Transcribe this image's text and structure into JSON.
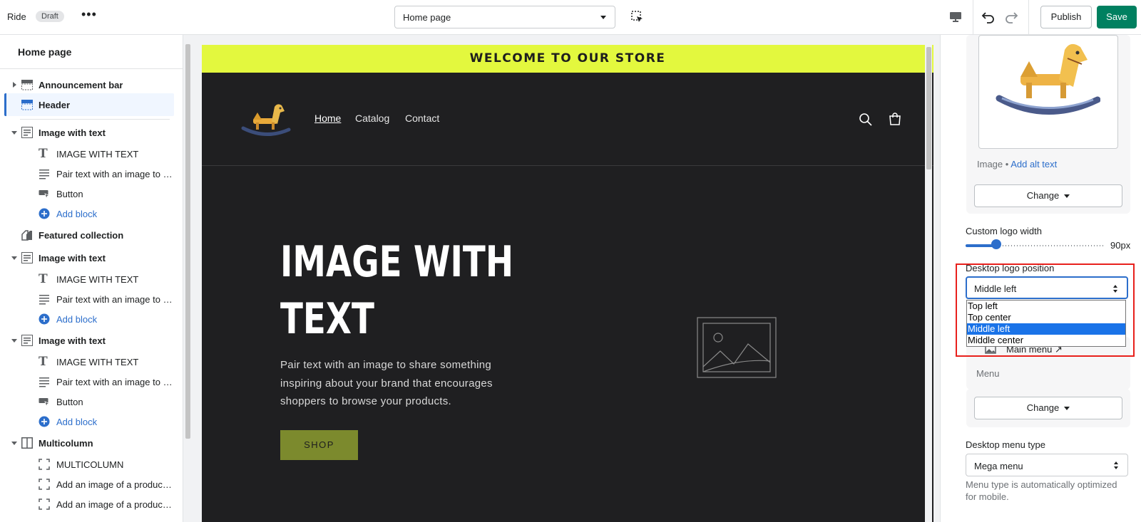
{
  "topbar": {
    "app_name": "Ride",
    "status_badge": "Draft",
    "more_label": "•••",
    "page_select_value": "Home page",
    "publish_label": "Publish",
    "save_label": "Save"
  },
  "sidebar": {
    "title": "Home page",
    "rows": {
      "announcement_bar": "Announcement bar",
      "header": "Header",
      "iwt1": "Image with text",
      "iwt1_heading": "IMAGE WITH TEXT",
      "iwt1_text": "Pair text with an image to s...",
      "iwt1_button": "Button",
      "iwt1_add": "Add block",
      "featured_collection": "Featured collection",
      "iwt2": "Image with text",
      "iwt2_heading": "IMAGE WITH TEXT",
      "iwt2_text": "Pair text with an image to s...",
      "iwt2_add": "Add block",
      "iwt3": "Image with text",
      "iwt3_heading": "IMAGE WITH TEXT",
      "iwt3_text": "Pair text with an image to f...",
      "iwt3_button": "Button",
      "iwt3_add": "Add block",
      "multicolumn": "Multicolumn",
      "mc_heading": "MULTICOLUMN",
      "mc_col1": "Add an image of a product ...",
      "mc_col2": "Add an image of a product ..."
    }
  },
  "preview": {
    "announcement": "WELCOME TO OUR STORE",
    "nav": {
      "home": "Home",
      "catalog": "Catalog",
      "contact": "Contact"
    },
    "hero": {
      "title_line1": "IMAGE WITH",
      "title_line2": "TEXT",
      "text": "Pair text with an image to share something inspiring about your brand that encourages shoppers to browse your products.",
      "button": "SHOP"
    }
  },
  "settings": {
    "image_label": "Image",
    "alt_text_link": "Add alt text",
    "change_label": "Change",
    "logo_width_label": "Custom logo width",
    "logo_width_value": "90px",
    "logo_width_fraction": 0.17,
    "logo_position_label": "Desktop logo position",
    "logo_position_value": "Middle left",
    "logo_position_options": [
      "Top left",
      "Top center",
      "Middle left",
      "Middle center"
    ],
    "menu_link": "Main menu",
    "menu_caption": "Menu",
    "menu_change_label": "Change",
    "menu_type_label": "Desktop menu type",
    "menu_type_value": "Mega menu",
    "menu_type_help": "Menu type is automatically optimized for mobile."
  },
  "colors": {
    "accent": "#2c6ecb",
    "save": "#008060",
    "announcement_bg": "#e3f83e",
    "store_bg": "#1f1f21",
    "hero_button": "#7c8a2d",
    "highlight": "#e8201c"
  }
}
